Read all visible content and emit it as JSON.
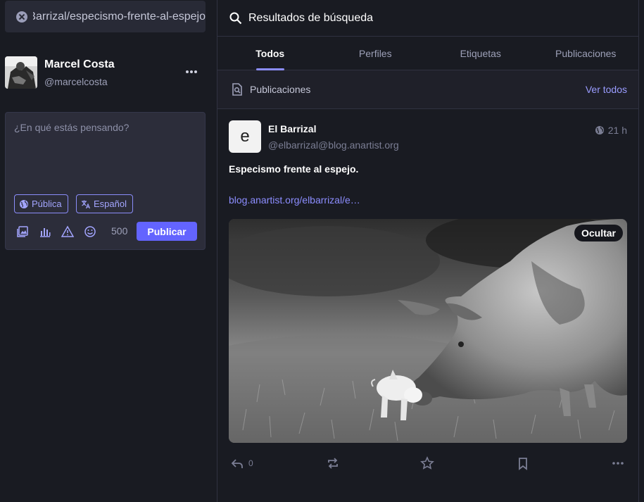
{
  "search": {
    "value": "Barrizal/especismo-frente-al-espejo"
  },
  "account": {
    "name": "Marcel Costa",
    "handle": "@marcelcosta"
  },
  "composer": {
    "placeholder": "¿En qué estás pensando?",
    "visibility": "Pública",
    "language": "Español",
    "char_count": "500",
    "publish_label": "Publicar"
  },
  "results": {
    "title": "Resultados de búsqueda",
    "tabs": [
      {
        "label": "Todos",
        "active": true
      },
      {
        "label": "Perfiles"
      },
      {
        "label": "Etiquetas"
      },
      {
        "label": "Publicaciones"
      }
    ],
    "section": {
      "title": "Publicaciones",
      "see_all": "Ver todos"
    }
  },
  "status": {
    "avatar_letter": "e",
    "display_name": "El Barrizal",
    "handle": "@elbarrizal@blog.anartist.org",
    "time": "21 h",
    "title": "Especismo frente al espejo.",
    "link": "blog.anartist.org/elbarrizal/e…",
    "media_hide_label": "Ocultar",
    "reply_count": "0"
  },
  "colors": {
    "accent": "#6364ff",
    "link": "#8c8dff",
    "background": "#191b22"
  }
}
